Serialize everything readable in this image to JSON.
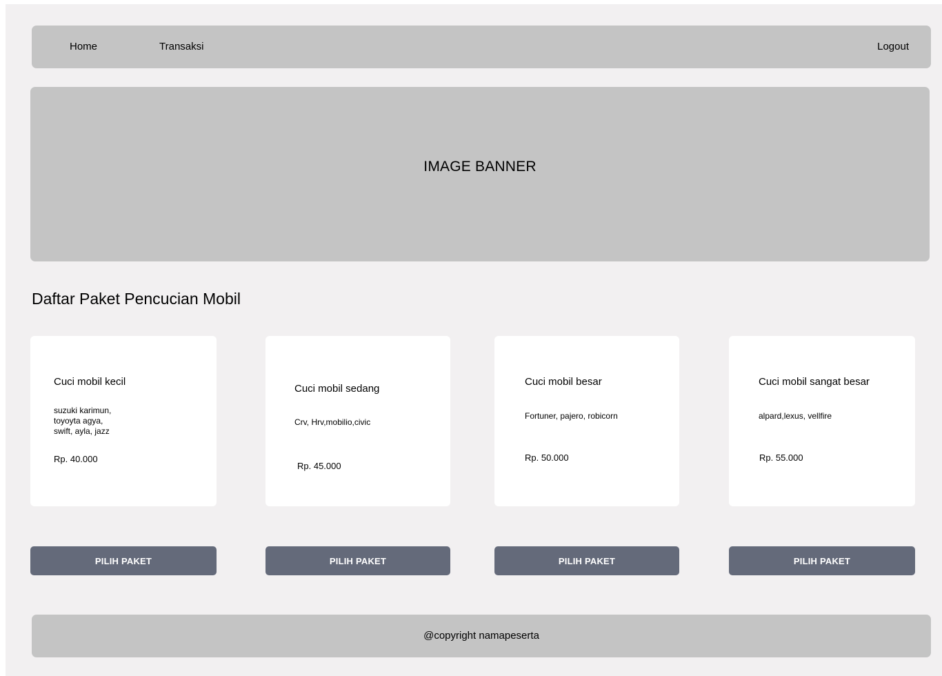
{
  "navbar": {
    "home": "Home",
    "transaksi": "Transaksi",
    "logout": "Logout"
  },
  "banner": {
    "text": "IMAGE BANNER"
  },
  "section": {
    "title": "Daftar Paket Pencucian Mobil"
  },
  "packages": [
    {
      "title": "Cuci  mobil kecil",
      "description": "suzuki karimun,\ntoyoyta agya,\nswift, ayla, jazz",
      "price": "Rp. 40.000",
      "button": "PILIH PAKET"
    },
    {
      "title": "Cuci  mobil sedang",
      "description": "Crv, Hrv,mobilio,civic",
      "price": "Rp. 45.000",
      "button": "PILIH PAKET"
    },
    {
      "title": "Cuci  mobil besar",
      "description": "Fortuner, pajero, robicorn",
      "price": "Rp. 50.000",
      "button": "PILIH PAKET"
    },
    {
      "title": "Cuci  mobil sangat besar",
      "description": "alpard,lexus, vellfire",
      "price": "Rp. 55.000",
      "button": "PILIH PAKET"
    }
  ],
  "footer": {
    "text": "@copyright namapeserta"
  },
  "colors": {
    "page_background": "#f2f0f1",
    "placeholder_gray": "#c4c4c4",
    "card_background": "#ffffff",
    "button_background": "#646a7a",
    "button_text": "#ffffff"
  }
}
